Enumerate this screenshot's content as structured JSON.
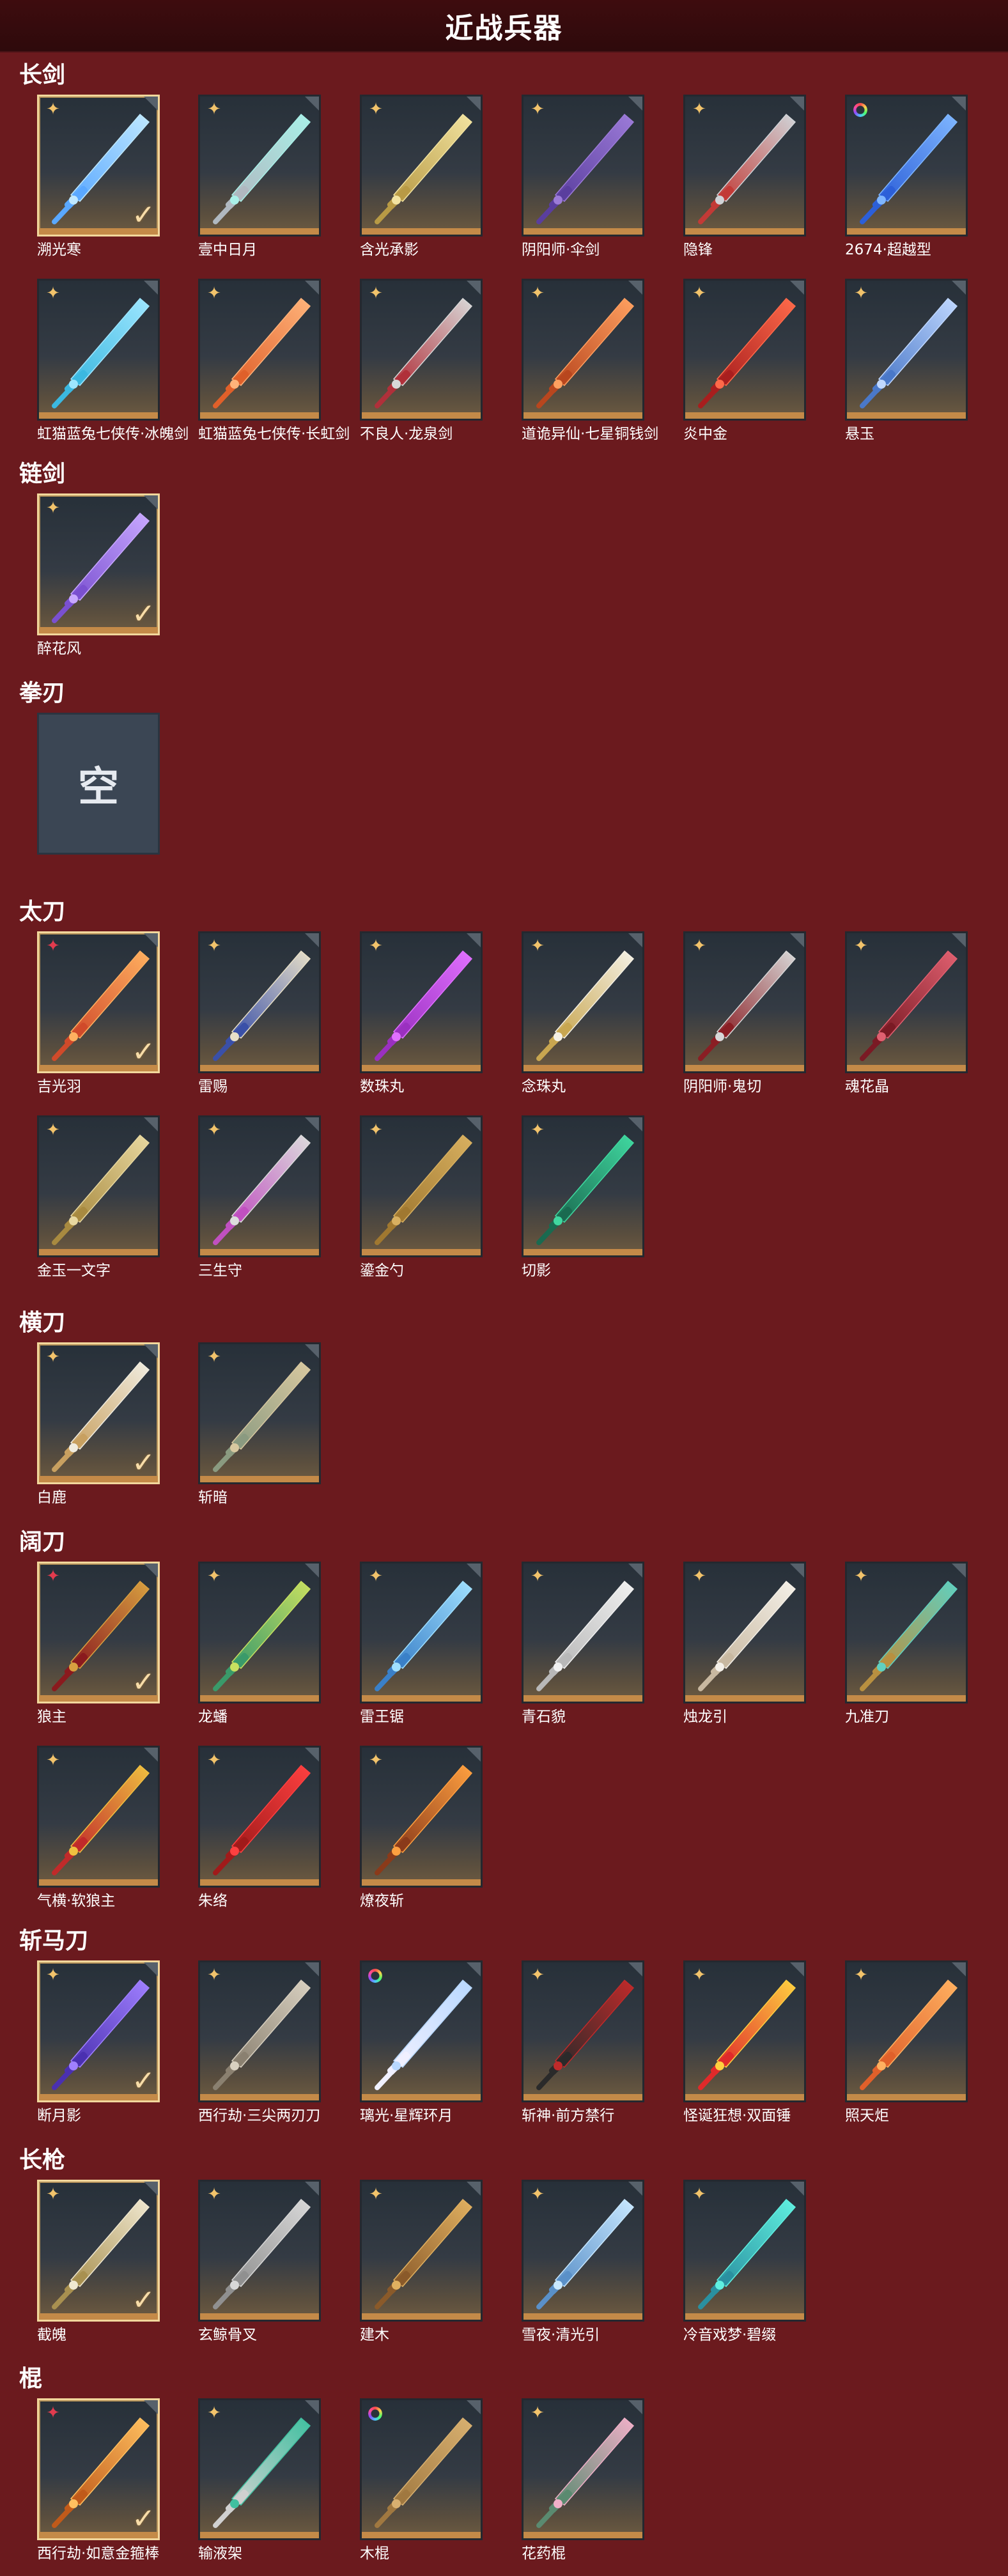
{
  "page": {
    "title": "近战兵器"
  },
  "colors": {
    "background": "#6b1a1e",
    "title_bar": "#2e0a0c",
    "tile_border_selected": "#f2d79c",
    "tile_bottom_band": "#c48a48",
    "rarity_gold": "#f2c36b",
    "rarity_red": "#e23b4e"
  },
  "sections": [
    {
      "title": "长剑",
      "items": [
        {
          "name": "溯光寒",
          "rarity": "gold",
          "selected": true,
          "c1": "#bfe8ff",
          "c2": "#5aa8ff",
          "icon": "ice-sword-icon"
        },
        {
          "name": "壹中日月",
          "rarity": "gold",
          "selected": false,
          "c1": "#a9f0e8",
          "c2": "#b0b8c0",
          "icon": "jade-sword-icon"
        },
        {
          "name": "含光承影",
          "rarity": "gold",
          "selected": false,
          "c1": "#f2e3a0",
          "c2": "#b89a45",
          "icon": "golden-sword-icon"
        },
        {
          "name": "阴阳师·伞剑",
          "rarity": "gold",
          "selected": false,
          "c1": "#9c7bd8",
          "c2": "#5a3e9e",
          "icon": "umbrella-sword-icon"
        },
        {
          "name": "隐锋",
          "rarity": "gold",
          "selected": false,
          "c1": "#d0d4d8",
          "c2": "#c23a36",
          "icon": "hidden-blade-icon"
        },
        {
          "name": "2674·超越型",
          "rarity": "ring",
          "selected": false,
          "c1": "#7fb6ff",
          "c2": "#2c5fd8",
          "icon": "tech-sword-icon"
        },
        {
          "name": "虹猫蓝兔七侠传·冰魄剑",
          "rarity": "gold",
          "selected": false,
          "c1": "#9ee6ff",
          "c2": "#3bb8e0",
          "icon": "ice-soul-sword-icon"
        },
        {
          "name": "虹猫蓝兔七侠传·长虹剑",
          "rarity": "gold",
          "selected": false,
          "c1": "#ffb37a",
          "c2": "#e0602a",
          "icon": "rainbow-sword-icon"
        },
        {
          "name": "不良人·龙泉剑",
          "rarity": "gold",
          "selected": false,
          "c1": "#d8d8d8",
          "c2": "#b0303a",
          "icon": "longquan-sword-icon"
        },
        {
          "name": "道诡异仙·七星铜钱剑",
          "rarity": "gold",
          "selected": false,
          "c1": "#ffa060",
          "c2": "#b8461e",
          "icon": "coin-sword-icon"
        },
        {
          "name": "炎中金",
          "rarity": "gold",
          "selected": false,
          "c1": "#ff6a4a",
          "c2": "#a81e1e",
          "icon": "flame-sword-icon"
        },
        {
          "name": "悬玉",
          "rarity": "gold",
          "selected": false,
          "c1": "#c0d8ff",
          "c2": "#4a78c8",
          "icon": "jade-pendant-sword-icon"
        }
      ]
    },
    {
      "title": "链剑",
      "items": [
        {
          "name": "醉花风",
          "rarity": "gold",
          "selected": true,
          "c1": "#c8a8ff",
          "c2": "#7a50d0",
          "icon": "chain-sword-icon"
        }
      ]
    },
    {
      "title": "拳刃",
      "items": [
        {
          "name": "",
          "empty": true,
          "empty_label": "空"
        }
      ]
    },
    {
      "title": "太刀",
      "items": [
        {
          "name": "吉光羽",
          "rarity": "red",
          "selected": true,
          "c1": "#ffb060",
          "c2": "#d04a2a",
          "icon": "phoenix-katana-icon"
        },
        {
          "name": "雷赐",
          "rarity": "gold",
          "selected": false,
          "c1": "#e8e0c8",
          "c2": "#3a50a8",
          "icon": "thunder-katana-icon"
        },
        {
          "name": "数珠丸",
          "rarity": "gold",
          "selected": false,
          "c1": "#e070ff",
          "c2": "#9a30c0",
          "icon": "bead-katana-icon"
        },
        {
          "name": "念珠丸",
          "rarity": "gold",
          "selected": false,
          "c1": "#f4f0e4",
          "c2": "#c8a650",
          "icon": "rosary-katana-icon"
        },
        {
          "name": "阴阳师·鬼切",
          "rarity": "gold",
          "selected": false,
          "c1": "#d8d8d8",
          "c2": "#8a1e24",
          "icon": "onikiri-katana-icon"
        },
        {
          "name": "魂花晶",
          "rarity": "gold",
          "selected": false,
          "c1": "#e06070",
          "c2": "#7a1a24",
          "icon": "crystal-katana-icon"
        },
        {
          "name": "金玉一文字",
          "rarity": "gold",
          "selected": false,
          "c1": "#e8d8a0",
          "c2": "#a88a40",
          "icon": "gold-jade-katana-icon"
        },
        {
          "name": "三生守",
          "rarity": "gold",
          "selected": false,
          "c1": "#dcdcdc",
          "c2": "#c050c0",
          "icon": "three-lives-katana-icon"
        },
        {
          "name": "鎏金勺",
          "rarity": "gold",
          "selected": false,
          "c1": "#d8b060",
          "c2": "#a07830",
          "icon": "golden-spoon-icon"
        },
        {
          "name": "切影",
          "rarity": "gold",
          "selected": false,
          "c1": "#40d8a0",
          "c2": "#1a6a50",
          "icon": "shadow-katana-icon"
        }
      ]
    },
    {
      "title": "横刀",
      "items": [
        {
          "name": "白鹿",
          "rarity": "gold",
          "selected": true,
          "c1": "#f0ece0",
          "c2": "#c8a060",
          "icon": "white-deer-blade-icon"
        },
        {
          "name": "斩暗",
          "rarity": "gold",
          "selected": false,
          "c1": "#d8c8a0",
          "c2": "#8a9a80",
          "icon": "darkslayer-blade-icon"
        }
      ]
    },
    {
      "title": "阔刀",
      "items": [
        {
          "name": "狼主",
          "rarity": "red",
          "selected": true,
          "c1": "#d8a040",
          "c2": "#8a1a1e",
          "icon": "wolf-broadsword-icon"
        },
        {
          "name": "龙蟠",
          "rarity": "gold",
          "selected": false,
          "c1": "#c8e060",
          "c2": "#3a9a6a",
          "icon": "dragon-broadsword-icon"
        },
        {
          "name": "雷王锯",
          "rarity": "gold",
          "selected": false,
          "c1": "#a0e0ff",
          "c2": "#3a80c8",
          "icon": "thunder-saw-icon"
        },
        {
          "name": "青石貌",
          "rarity": "gold",
          "selected": false,
          "c1": "#f0f0f0",
          "c2": "#b8b8b8",
          "icon": "bluestone-broadsword-icon"
        },
        {
          "name": "烛龙引",
          "rarity": "gold",
          "selected": false,
          "c1": "#f4f0e8",
          "c2": "#c8b8a0",
          "icon": "candle-dragon-icon"
        },
        {
          "name": "九准刀",
          "rarity": "gold",
          "selected": false,
          "c1": "#60d0c0",
          "c2": "#b89040",
          "icon": "nine-blade-icon"
        },
        {
          "name": "气横·软狼主",
          "rarity": "gold",
          "selected": false,
          "c1": "#f0c040",
          "c2": "#c02a2a",
          "icon": "soft-wolf-icon"
        },
        {
          "name": "朱络",
          "rarity": "gold",
          "selected": false,
          "c1": "#ff4040",
          "c2": "#a01a1a",
          "icon": "crimson-broadsword-icon"
        },
        {
          "name": "燎夜斩",
          "rarity": "gold",
          "selected": false,
          "c1": "#ffa040",
          "c2": "#8a3a1a",
          "icon": "night-blaze-icon"
        }
      ]
    },
    {
      "title": "斩马刀",
      "items": [
        {
          "name": "断月影",
          "rarity": "gold",
          "selected": true,
          "c1": "#a080ff",
          "c2": "#4a30b0",
          "icon": "moon-glaive-icon"
        },
        {
          "name": "西行劫·三尖两刃刀",
          "rarity": "gold",
          "selected": false,
          "c1": "#d8d0c0",
          "c2": "#8a8070",
          "icon": "trident-glaive-icon"
        },
        {
          "name": "璃光·星辉环月",
          "rarity": "ring",
          "selected": false,
          "c1": "#b8d8ff",
          "c2": "#f0f0ff",
          "icon": "star-ring-glaive-icon"
        },
        {
          "name": "斩神·前方禁行",
          "rarity": "gold",
          "selected": false,
          "c1": "#c02a2a",
          "c2": "#2a2a2a",
          "icon": "no-entry-glaive-icon"
        },
        {
          "name": "怪诞狂想·双面锤",
          "rarity": "gold",
          "selected": false,
          "c1": "#ffd040",
          "c2": "#e02a2a",
          "icon": "fantasy-hammer-icon"
        },
        {
          "name": "照天炬",
          "rarity": "gold",
          "selected": false,
          "c1": "#ffb060",
          "c2": "#e0602a",
          "icon": "sky-torch-icon"
        }
      ]
    },
    {
      "title": "长枪",
      "items": [
        {
          "name": "截魄",
          "rarity": "gold",
          "selected": true,
          "c1": "#f0e8d0",
          "c2": "#a89050",
          "icon": "soul-spear-icon"
        },
        {
          "name": "玄鲸骨叉",
          "rarity": "gold",
          "selected": false,
          "c1": "#d8d8d8",
          "c2": "#909090",
          "icon": "whalebone-fork-icon"
        },
        {
          "name": "建木",
          "rarity": "gold",
          "selected": false,
          "c1": "#e0b060",
          "c2": "#8a5a2a",
          "icon": "world-tree-spear-icon"
        },
        {
          "name": "雪夜·清光引",
          "rarity": "gold",
          "selected": false,
          "c1": "#c8e8ff",
          "c2": "#5a90c8",
          "icon": "snow-night-spear-icon"
        },
        {
          "name": "冷音戏梦·碧缀",
          "rarity": "gold",
          "selected": false,
          "c1": "#60f0e0",
          "c2": "#2a90a0",
          "icon": "jade-dream-spear-icon"
        }
      ]
    },
    {
      "title": "棍",
      "items": [
        {
          "name": "西行劫·如意金箍棒",
          "rarity": "red",
          "selected": true,
          "c1": "#ffc060",
          "c2": "#c05a1a",
          "icon": "golden-staff-icon"
        },
        {
          "name": "输液架",
          "rarity": "gold",
          "selected": false,
          "c1": "#40c0a0",
          "c2": "#d0d0d0",
          "icon": "iv-stand-icon"
        },
        {
          "name": "木棍",
          "rarity": "ring",
          "selected": false,
          "c1": "#d8b070",
          "c2": "#a07840",
          "icon": "wooden-stick-icon"
        },
        {
          "name": "花药棍",
          "rarity": "gold",
          "selected": false,
          "c1": "#f0b0c8",
          "c2": "#5a8a70",
          "icon": "flower-staff-icon"
        }
      ]
    }
  ]
}
